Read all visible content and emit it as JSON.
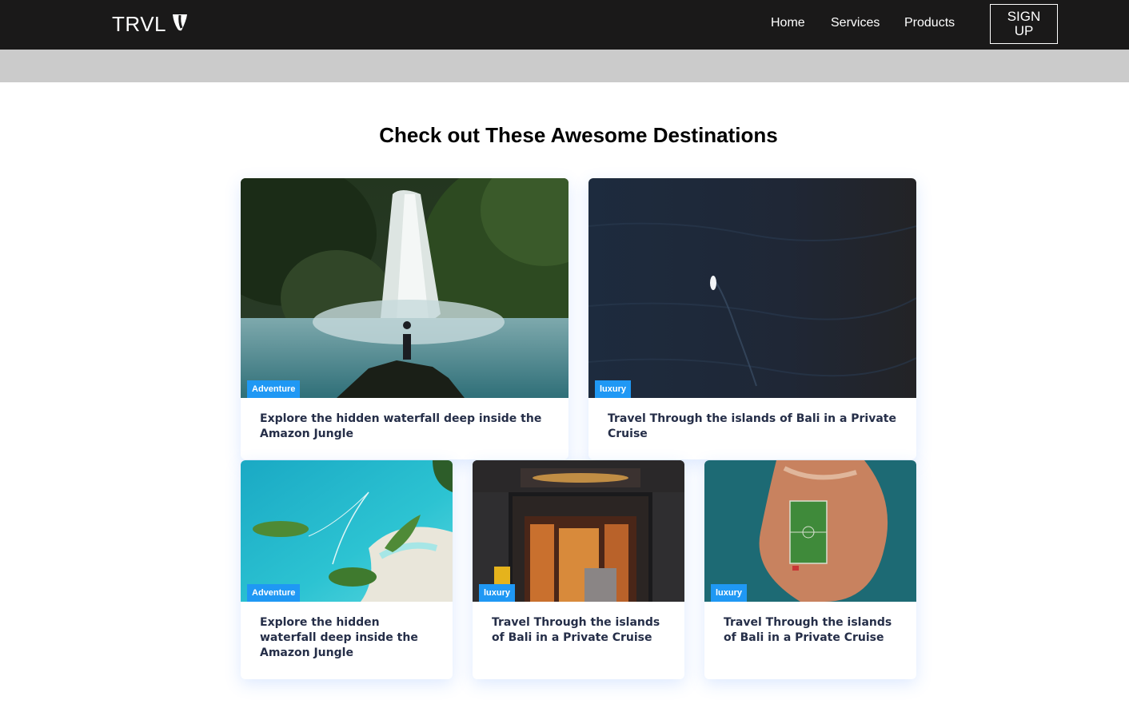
{
  "navbar": {
    "logo_text": "TRVL",
    "links": [
      "Home",
      "Services",
      "Products"
    ],
    "signup_label": "SIGN UP",
    "background": "#1a1919"
  },
  "main": {
    "title": "Check out These Awesome Destinations"
  },
  "cards": [
    {
      "label": "Adventure",
      "text": "Explore the hidden waterfall deep inside the Amazon Jungle",
      "image": "waterfall-photo"
    },
    {
      "label": "luxury",
      "text": "Travel Through the islands of Bali in a Private Cruise",
      "image": "ocean-boat-photo"
    },
    {
      "label": "Adventure",
      "text": "Explore the hidden waterfall deep inside the Amazon Jungle",
      "image": "turquoise-islands-photo"
    },
    {
      "label": "luxury",
      "text": "Travel Through the islands of Bali in a Private Cruise",
      "image": "hotel-entrance-photo"
    },
    {
      "label": "luxury",
      "text": "Travel Through the islands of Bali in a Private Cruise",
      "image": "island-stadium-photo"
    }
  ],
  "colors": {
    "badge": "#1f98f4",
    "card_text": "#252e48",
    "grey_band": "#cbcbcb"
  }
}
